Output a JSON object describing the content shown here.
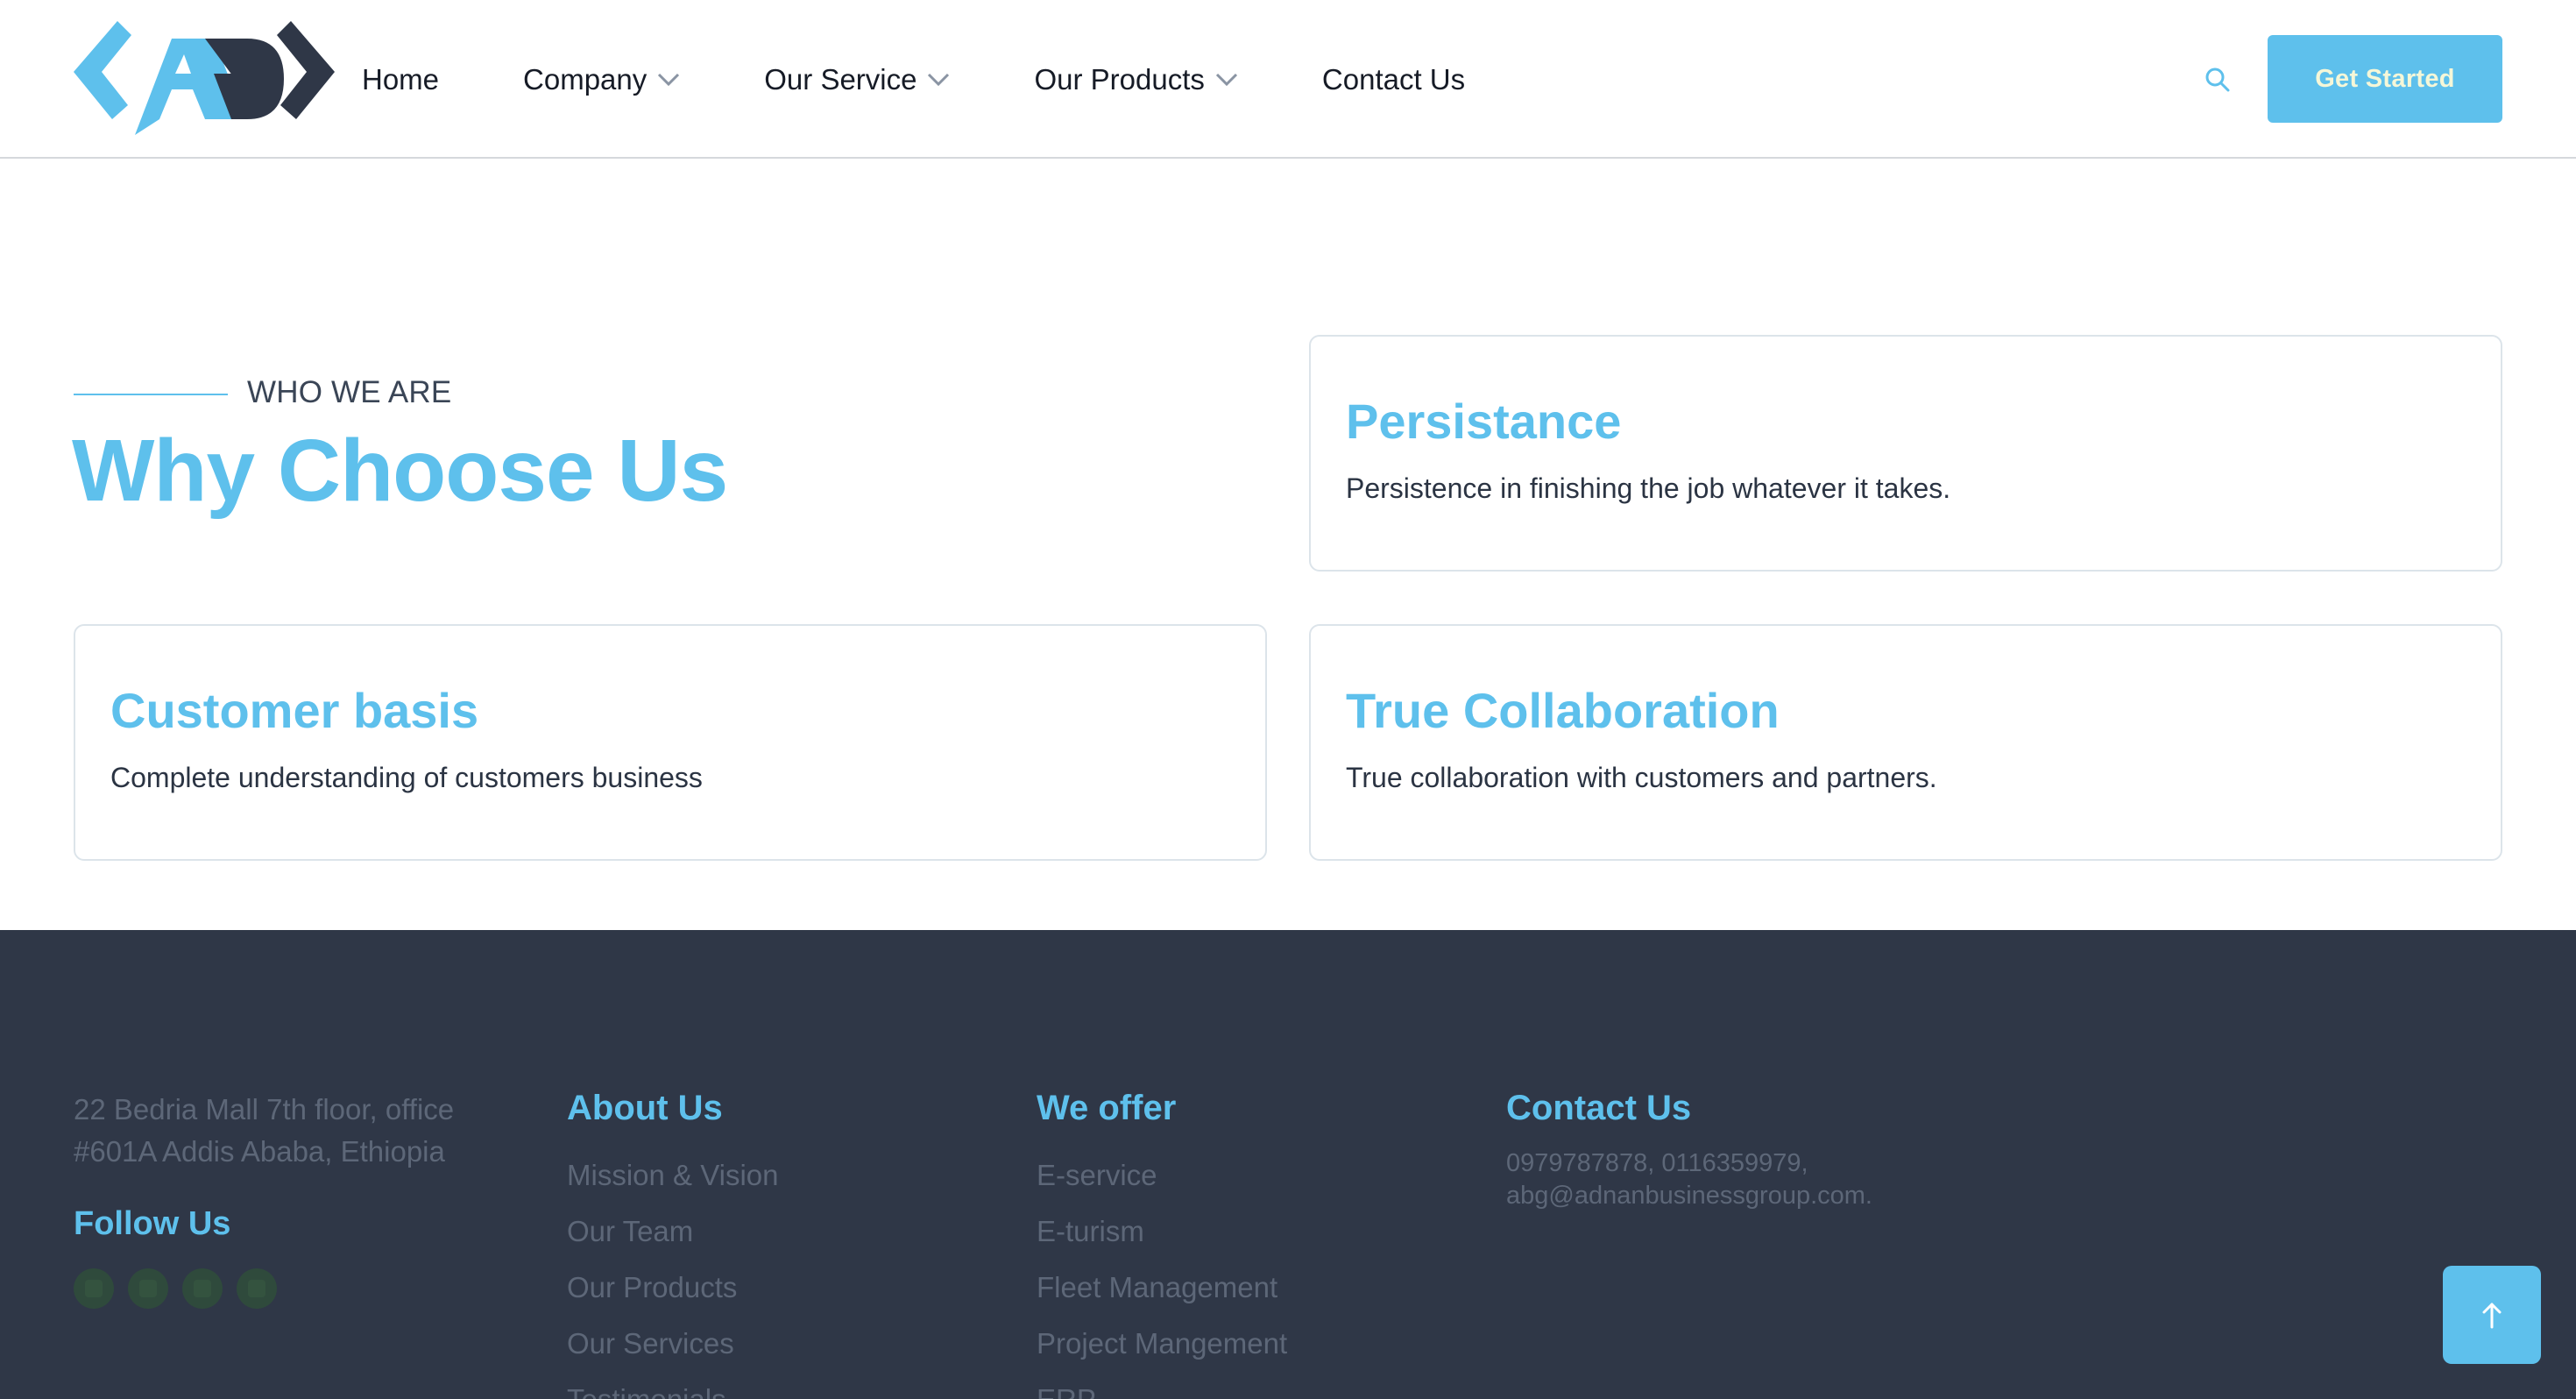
{
  "header": {
    "logo_alt": "ABD",
    "nav": [
      {
        "label": "Home",
        "has_dropdown": false
      },
      {
        "label": "Company",
        "has_dropdown": true
      },
      {
        "label": "Our Service",
        "has_dropdown": true
      },
      {
        "label": "Our Products",
        "has_dropdown": true
      },
      {
        "label": "Contact Us",
        "has_dropdown": false
      }
    ],
    "search_icon": "search-icon",
    "cta_label": "Get Started"
  },
  "why": {
    "eyebrow": "WHO WE ARE",
    "title": "Why Choose Us",
    "cards": [
      {
        "title": "Persistance",
        "text": "Persistence in finishing the job whatever it takes."
      },
      {
        "title": "Customer basis",
        "text": "Complete understanding of customers business"
      },
      {
        "title": "True Collaboration",
        "text": "True collaboration with customers and partners."
      }
    ]
  },
  "footer": {
    "address_line1": "22 Bedria Mall 7th floor, office",
    "address_line2": "#601A Addis Ababa, Ethiopia",
    "follow_title": "Follow Us",
    "social_icons": [
      "facebook-icon",
      "twitter-icon",
      "instagram-icon",
      "linkedin-icon"
    ],
    "about": {
      "title": "About Us",
      "links": [
        "Mission & Vision",
        "Our Team",
        "Our Products",
        "Our Services",
        "Testimonials"
      ]
    },
    "offer": {
      "title": "We offer",
      "links": [
        "E-service",
        "E-turism",
        "Fleet Management",
        "Project Mangement",
        "ERP"
      ]
    },
    "contact": {
      "title": "Contact Us",
      "phones": "0979787878, 0116359979,",
      "email": "abg@adnanbusinessgroup.com."
    }
  },
  "colors": {
    "accent": "#5ec0ec",
    "logo_dark": "#2f3747",
    "footer_bg": "#2f3747",
    "muted_text": "#5d6778"
  },
  "scroll_top_icon": "arrow-up-icon"
}
